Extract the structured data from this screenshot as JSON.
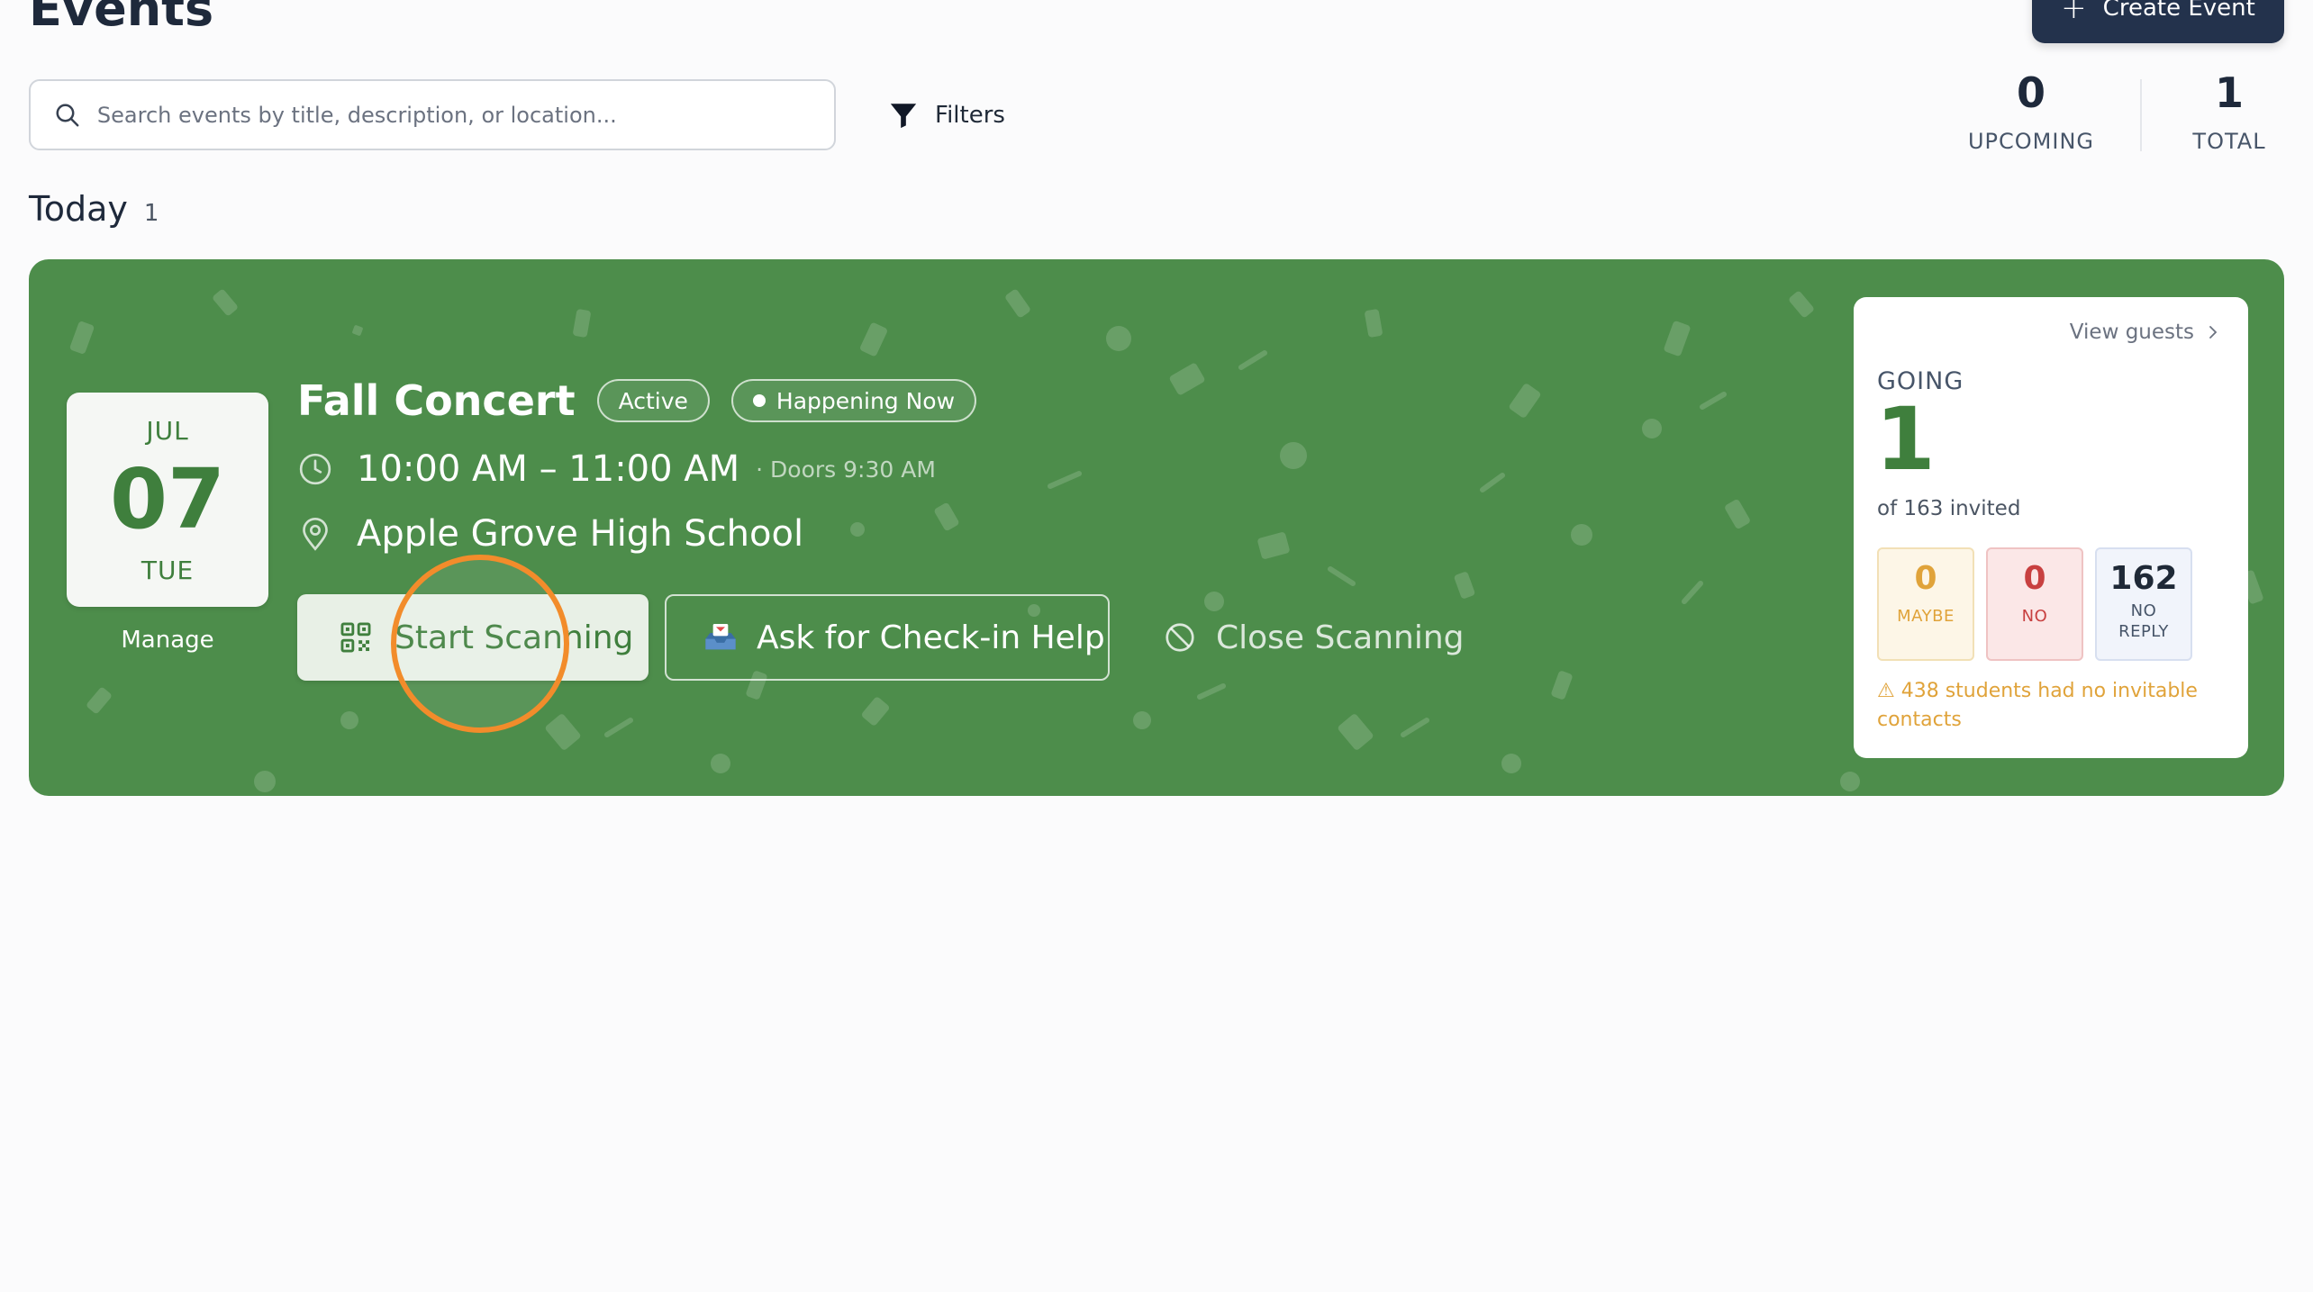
{
  "page": {
    "title": "Events",
    "create_button_label": "Create Event"
  },
  "search": {
    "placeholder": "Search events by title, description, or location...",
    "value": ""
  },
  "filters": {
    "label": "Filters"
  },
  "stats": {
    "upcoming": {
      "value": "0",
      "label": "UPCOMING"
    },
    "total": {
      "value": "1",
      "label": "TOTAL"
    }
  },
  "section": {
    "title": "Today",
    "count": "1"
  },
  "event": {
    "month": "JUL",
    "day": "07",
    "weekday": "TUE",
    "manage_label": "Manage",
    "title": "Fall Concert",
    "status_badge": "Active",
    "live_badge": "Happening Now",
    "time": "10:00 AM – 11:00 AM",
    "doors": "· Doors 9:30 AM",
    "location": "Apple Grove High School",
    "start_scanning_label": "Start Scanning",
    "check_in_help_label": "Ask for Check-in Help",
    "close_scanning_label": "Close Scanning",
    "card_color": "#4d8d4b"
  },
  "guests": {
    "view_label": "View guests",
    "going_label": "GOING",
    "going_count": "1",
    "invited_text": "of 163 invited",
    "maybe": {
      "value": "0",
      "label": "MAYBE"
    },
    "no": {
      "value": "0",
      "label": "NO"
    },
    "no_reply": {
      "value": "162",
      "label_line1": "NO",
      "label_line2": "REPLY"
    },
    "warning_text": "⚠ 438 students had no invitable contacts"
  },
  "icons": {
    "search": "search-icon",
    "filter": "filter-icon",
    "plus": "plus-icon",
    "clock": "clock-icon",
    "location": "map-pin-icon",
    "qr": "qr-code-icon",
    "inbox": "inbox-tray-icon",
    "ban": "ban-icon",
    "chevron": "chevron-right-icon"
  }
}
